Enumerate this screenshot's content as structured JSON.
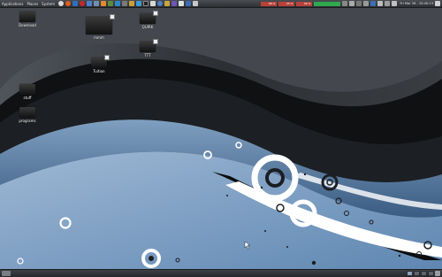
{
  "top_panel": {
    "menus": [
      "Applications",
      "Places",
      "System"
    ],
    "monitors": [
      {
        "label": "88 %",
        "color": "#b8423a"
      },
      {
        "label": "95 %",
        "color": "#b8423a"
      },
      {
        "label": "96 %",
        "color": "#b8423a"
      },
      {
        "label": "",
        "color": "#2fa84f"
      }
    ],
    "clock": "Fri Mar 26 , 10:40:13"
  },
  "desktop": {
    "icons": [
      {
        "label": "Download"
      },
      {
        "label": "mmm"
      },
      {
        "label": "QUIRK"
      },
      {
        "label": "Tuition"
      },
      {
        "label": "TTT"
      },
      {
        "label": "stuff"
      },
      {
        "label": "programs"
      }
    ]
  },
  "colors": {
    "wallpaper_dark": "#111315",
    "wallpaper_blue": "#5f87b2",
    "ring": "#ffffff"
  }
}
